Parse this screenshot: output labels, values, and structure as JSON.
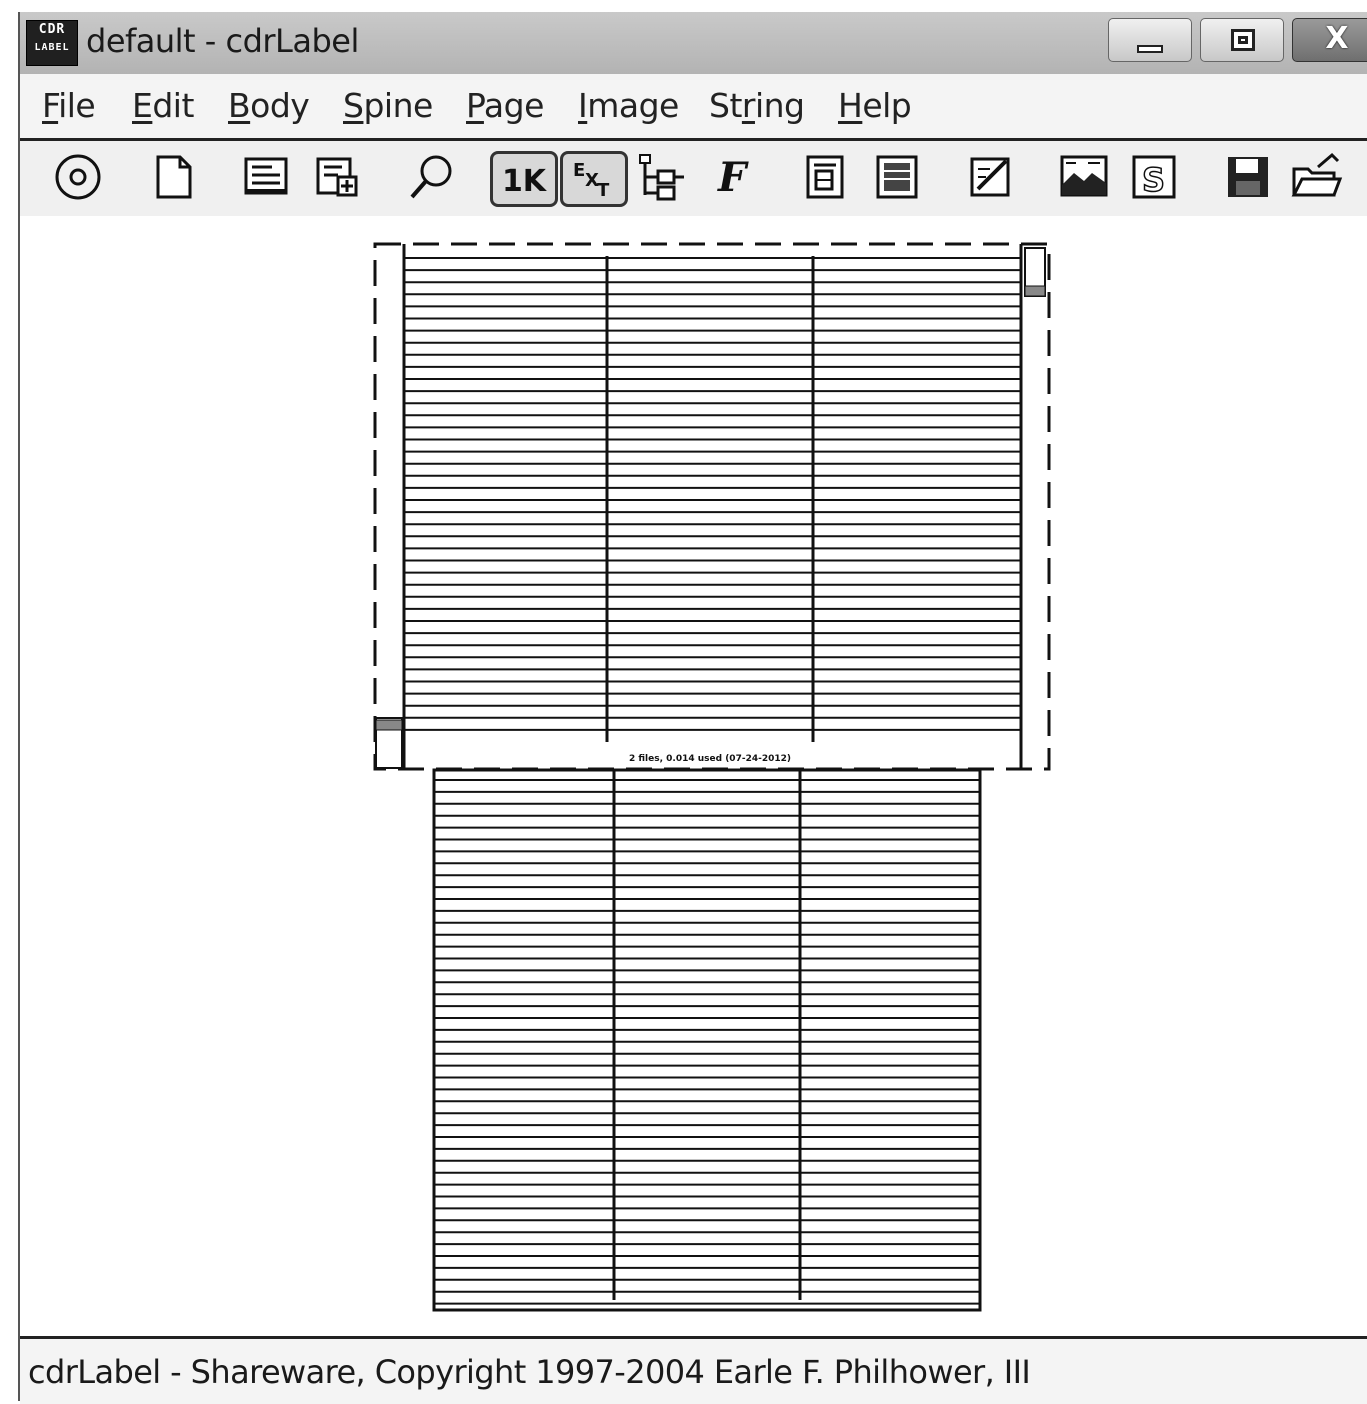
{
  "window": {
    "app_icon_text": [
      "CDR",
      "LABEL"
    ],
    "title": "default - cdrLabel",
    "close_glyph": "X"
  },
  "menu": {
    "items": [
      {
        "label": "File",
        "mnemonic": "F"
      },
      {
        "label": "Edit",
        "mnemonic": "E"
      },
      {
        "label": "Body",
        "mnemonic": "B"
      },
      {
        "label": "Spine",
        "mnemonic": "S"
      },
      {
        "label": "Page",
        "mnemonic": "P"
      },
      {
        "label": "Image",
        "mnemonic": "I"
      },
      {
        "label": "String",
        "mnemonic": "r"
      },
      {
        "label": "Help",
        "mnemonic": "H"
      }
    ]
  },
  "toolbar": {
    "buttons": [
      {
        "name": "cd-disc-icon"
      },
      {
        "name": "new-page-icon"
      },
      {
        "name": "body-text-icon"
      },
      {
        "name": "add-body-icon"
      },
      {
        "name": "zoom-icon"
      },
      {
        "name": "one-k-button",
        "label": "1K",
        "pressed": true
      },
      {
        "name": "ext-button",
        "label": "EXT",
        "pressed": true
      },
      {
        "name": "tree-icon"
      },
      {
        "name": "font-icon"
      },
      {
        "name": "spine-text-icon"
      },
      {
        "name": "spine-layout-icon"
      },
      {
        "name": "edit-icon"
      },
      {
        "name": "image-icon"
      },
      {
        "name": "string-icon"
      },
      {
        "name": "save-icon"
      },
      {
        "name": "open-icon"
      }
    ]
  },
  "label_preview": {
    "footer_text": "2 files, 0.014 used (07-24-2012)"
  },
  "status": {
    "text": "cdrLabel - Shareware, Copyright 1997-2004 Earle F. Philhower, III"
  }
}
